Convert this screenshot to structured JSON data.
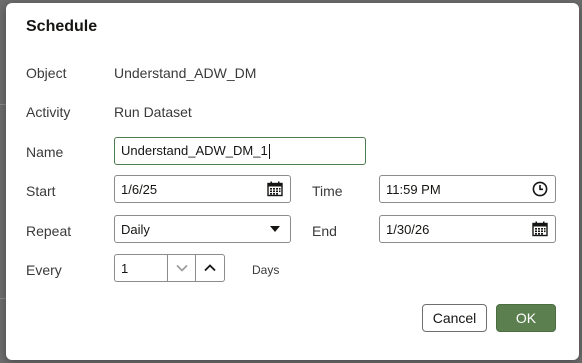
{
  "dialog": {
    "title": "Schedule",
    "object_label": "Object",
    "object_value": "Understand_ADW_DM",
    "activity_label": "Activity",
    "activity_value": "Run Dataset",
    "name_label": "Name",
    "name_value": "Understand_ADW_DM_1",
    "start_label": "Start",
    "start_value": "1/6/25",
    "time_label": "Time",
    "time_value": "11:59 PM",
    "repeat_label": "Repeat",
    "repeat_value": "Daily",
    "end_label": "End",
    "end_value": "1/30/26",
    "every_label": "Every",
    "every_value": "1",
    "every_unit": "Days",
    "cancel_label": "Cancel",
    "ok_label": "OK"
  },
  "icons": {
    "start_picker": "calendar-icon",
    "time_picker": "clock-icon",
    "repeat_dropdown": "caret-down-icon",
    "end_picker": "calendar-icon",
    "decrement": "chevron-down-icon",
    "increment": "chevron-up-icon"
  },
  "colors": {
    "ok_button": "#5b7f4f",
    "focus_border": "#4f7d4f",
    "overlay": "#6e6e6e"
  }
}
